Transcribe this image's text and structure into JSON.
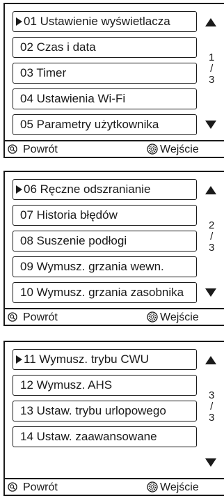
{
  "screens": [
    {
      "items": [
        "01 Ustawienie wyświetlacza",
        "02 Czas i data",
        "03 Timer",
        "04 Ustawienia Wi-Fi",
        "05 Parametry użytkownika"
      ],
      "page": {
        "current": "1",
        "sep": "/",
        "total": "3"
      }
    },
    {
      "items": [
        "06 Ręczne odszranianie",
        "07 Historia błędów",
        "08 Suszenie podłogi",
        "09 Wymusz. grzania wewn.",
        "10 Wymusz. grzania zasobnika"
      ],
      "page": {
        "current": "2",
        "sep": "/",
        "total": "3"
      }
    },
    {
      "items": [
        "11 Wymusz. trybu CWU",
        "12 Wymusz. AHS",
        "13 Ustaw. trybu urlopowego",
        "14 Ustaw. zaawansowane"
      ],
      "page": {
        "current": "3",
        "sep": "/",
        "total": "3"
      }
    }
  ],
  "footer": {
    "back_label": "Powrót",
    "enter_label": "Wejście"
  },
  "icons": {
    "selected": "triangle-right-icon",
    "scroll_up": "arrow-up-icon",
    "scroll_down": "arrow-down-icon",
    "back": "search-icon",
    "enter": "gear-icon"
  },
  "colors": {
    "foreground": "#1a1a1a",
    "background": "#ffffff"
  }
}
